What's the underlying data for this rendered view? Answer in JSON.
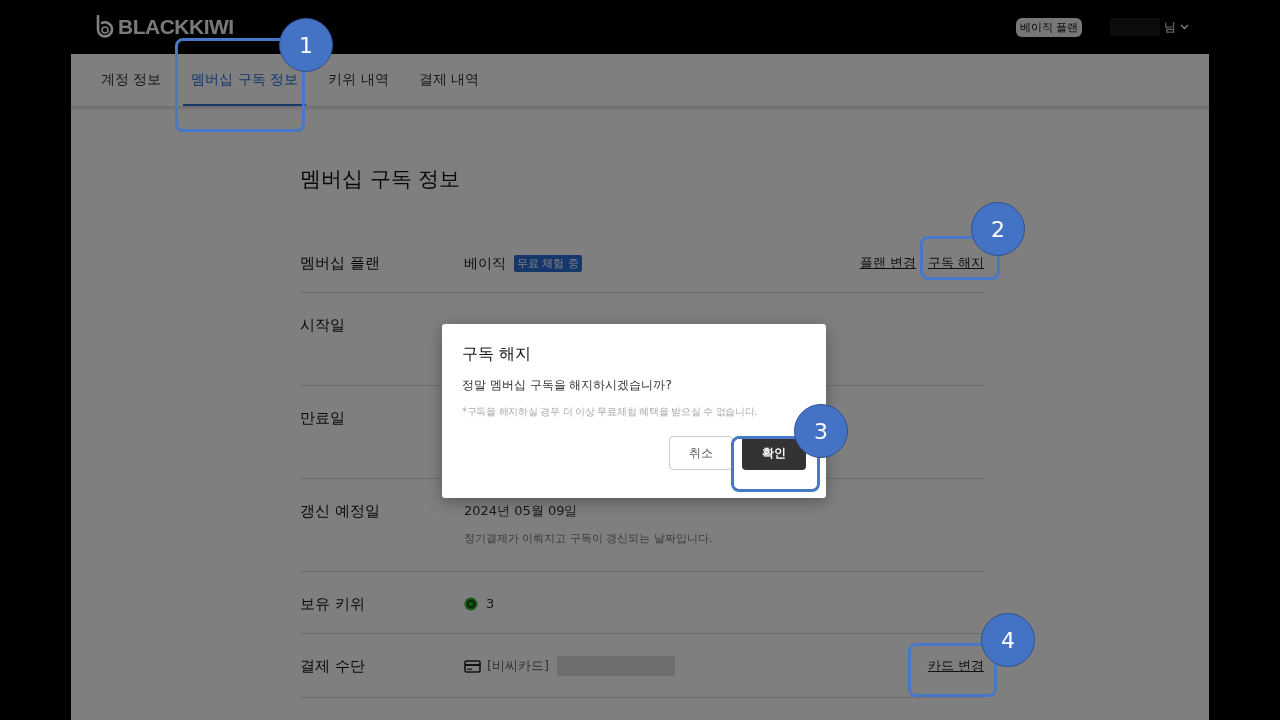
{
  "header": {
    "logo": "BLACKKIWI",
    "plan_badge": "베이직 플랜",
    "user_suffix": "님"
  },
  "tabs": [
    {
      "label": "계정 정보",
      "selected": false
    },
    {
      "label": "멤버십 구독 정보",
      "selected": true
    },
    {
      "label": "키위 내역",
      "selected": false
    },
    {
      "label": "결제 내역",
      "selected": false
    }
  ],
  "title": "멤버십 구독 정보",
  "rows": [
    {
      "kind": "plan",
      "label": "멤버십 플랜",
      "value": "베이직",
      "badge": "무료 체험 중",
      "actions": [
        "플랜 변경",
        "구독 해지"
      ]
    },
    {
      "kind": "date",
      "label": "시작일"
    },
    {
      "kind": "date",
      "label": "만료일"
    },
    {
      "kind": "date",
      "label": "갱신 예정일",
      "value": "2024년 05월 09일",
      "note": "정기결제가 이뤄지고 구독이 갱신되는 날짜입니다."
    },
    {
      "kind": "kiwi",
      "label": "보유 키위",
      "value": "3"
    },
    {
      "kind": "card",
      "label": "결제 수단",
      "value": "[비씨카드]",
      "actions": [
        "카드 변경"
      ]
    }
  ],
  "dialog": {
    "title": "구독 해지",
    "question": "정말 멤버십 구독을 해지하시겠습니까?",
    "note": "*구독을 해지하실 경우 더 이상 무료체험 혜택을 받으실 수 없습니다.",
    "buttons": [
      {
        "label": "취소",
        "kind": "secondary"
      },
      {
        "label": "확인",
        "kind": "primary"
      }
    ]
  },
  "callouts": [
    {
      "number": "1"
    },
    {
      "number": "2"
    },
    {
      "number": "3"
    },
    {
      "number": "4"
    }
  ]
}
